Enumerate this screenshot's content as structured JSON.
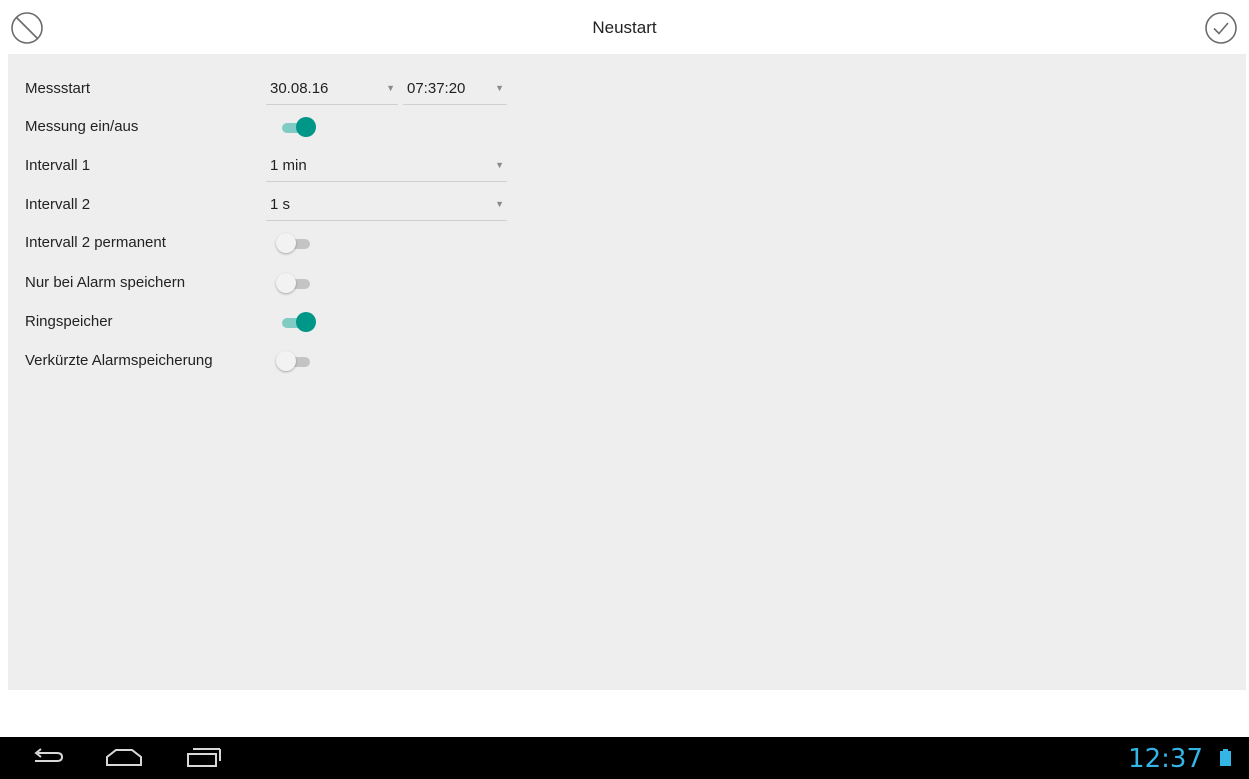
{
  "header": {
    "title": "Neustart",
    "cancel_icon": "cancel-circle-icon",
    "confirm_icon": "check-circle-icon"
  },
  "settings": {
    "messstart": {
      "label": "Messstart",
      "date": "30.08.16",
      "time": "07:37:20"
    },
    "messung": {
      "label": "Messung ein/aus",
      "on": true
    },
    "intervall1": {
      "label": "Intervall 1",
      "value": "1 min"
    },
    "intervall2": {
      "label": "Intervall 2",
      "value": "1 s"
    },
    "intervall2_permanent": {
      "label": "Intervall 2 permanent",
      "on": false
    },
    "nur_bei_alarm": {
      "label": "Nur bei Alarm speichern",
      "on": false
    },
    "ringspeicher": {
      "label": "Ringspeicher",
      "on": true
    },
    "verkuerzte_alarm": {
      "label": "Verkürzte Alarmspeicherung",
      "on": false
    }
  },
  "system_bar": {
    "time": "12:37",
    "nav_icons": [
      "back-icon",
      "home-icon",
      "recent-apps-icon"
    ],
    "battery_icon": "battery-icon"
  },
  "colors": {
    "accent": "#009688",
    "accent_track": "#80cbc4",
    "panel_bg": "#eeeeee",
    "clock": "#33b5e5"
  }
}
